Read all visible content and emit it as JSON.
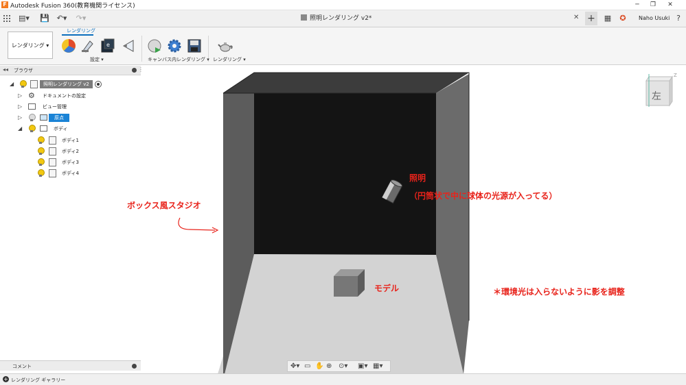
{
  "app": {
    "window_title": "Autodesk Fusion 360(教育機関ライセンス)",
    "document_tab": "照明レンダリング v2*",
    "user_name": "Naho Usuki"
  },
  "toolbar": {
    "workspace_label": "レンダリング ▾",
    "active_tab": "レンダリング",
    "groups": [
      {
        "label": "設定 ▾"
      },
      {
        "label": "キャンバス内レンダリング ▾"
      },
      {
        "label": "レンダリング ▾"
      }
    ],
    "tools": [
      "appearance-icon",
      "scene-settings-icon",
      "environment-icon",
      "decal-icon",
      "incanvas-render-icon",
      "render-settings-icon",
      "capture-image-icon",
      "render-teapot-icon"
    ]
  },
  "browser": {
    "title": "ブラウザ",
    "root": "照明レンダリング v2",
    "items": [
      {
        "label": "ドキュメントの設定"
      },
      {
        "label": "ビュー管理"
      },
      {
        "label": "原点"
      },
      {
        "label": "ボディ"
      }
    ],
    "bodies": [
      "ボディ1",
      "ボディ2",
      "ボディ3",
      "ボディ4"
    ]
  },
  "viewcube": {
    "face": "左"
  },
  "annotations": {
    "studio": "ボックス風スタジオ",
    "light_title": "照明",
    "light_desc": "（円筒状で中に球体の光源が入ってる）",
    "model": "モデル",
    "ambient_note": "＊環境光は入らないように影を調整"
  },
  "comments_label": "コメント",
  "gallery_label": "レンダリング ギャラリー",
  "colors": {
    "accent": "#1a83d6",
    "annotation": "#e8231b"
  }
}
